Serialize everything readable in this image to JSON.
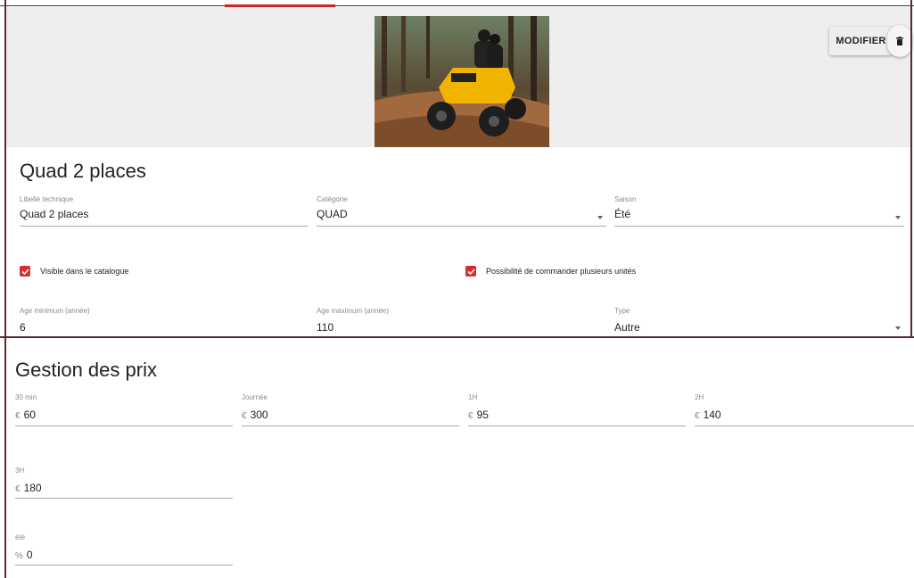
{
  "header": {
    "edit_label": "MODIFIER"
  },
  "product": {
    "title": "Quad 2 places",
    "fields": {
      "libelle": {
        "label": "Libellé technique",
        "value": "Quad 2 places"
      },
      "categorie": {
        "label": "Catégorie",
        "value": "QUAD"
      },
      "saison": {
        "label": "Saison",
        "value": "Été"
      },
      "age_min": {
        "label": "Age minimum (année)",
        "value": "6"
      },
      "age_max": {
        "label": "Age maximum (année)",
        "value": "110"
      },
      "type": {
        "label": "Type",
        "value": "Autre"
      }
    },
    "checkboxes": {
      "visible": {
        "label": "Visible dans le catalogue",
        "checked": true
      },
      "multi": {
        "label": "Possibilité de commander plusieurs unités",
        "checked": true
      }
    }
  },
  "pricing": {
    "title": "Gestion des prix",
    "prices": [
      {
        "label": "30 min",
        "prefix": "€",
        "value": "60"
      },
      {
        "label": "Journée",
        "prefix": "€",
        "value": "300"
      },
      {
        "label": "1H",
        "prefix": "€",
        "value": "95"
      },
      {
        "label": "2H",
        "prefix": "€",
        "value": "140"
      },
      {
        "label": "3H",
        "prefix": "€",
        "value": "180"
      }
    ],
    "season": {
      "label": "été",
      "prefix": "%",
      "value": "0"
    }
  },
  "colors": {
    "accent": "#d32f2f",
    "frame": "#5e2a30"
  },
  "icons": {
    "delete": "trash-icon",
    "dropdown": "arrow-down-icon",
    "checkbox": "check-icon"
  }
}
